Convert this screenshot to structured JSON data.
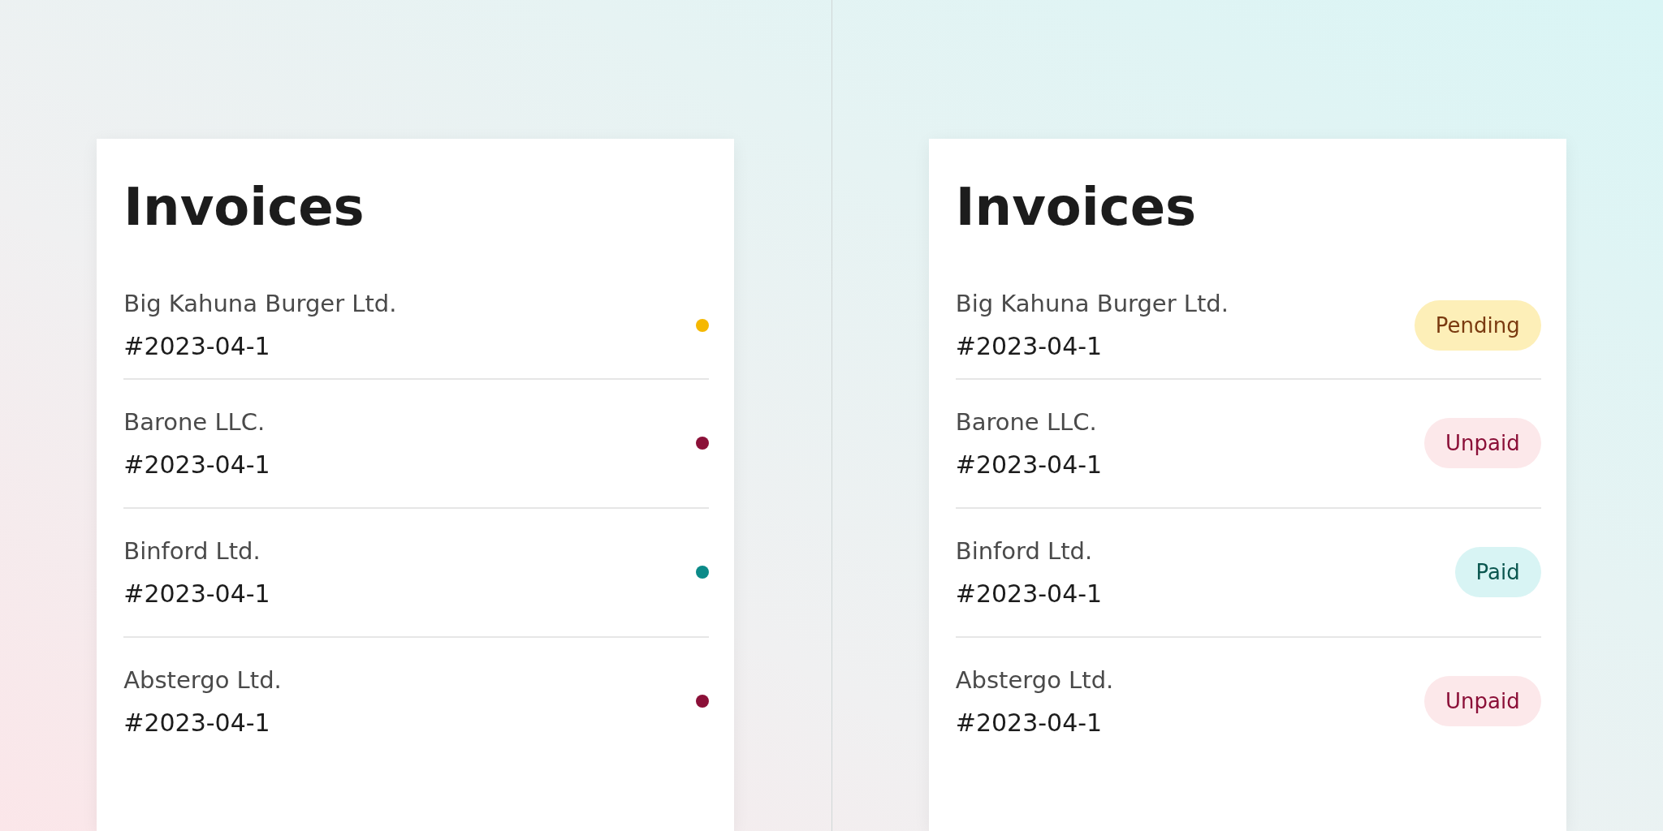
{
  "panels": [
    {
      "title": "Invoices",
      "items": [
        {
          "name": "Big Kahuna Burger Ltd.",
          "number": "#2023-04-1",
          "color": "#f5b800"
        },
        {
          "name": "Barone LLC.",
          "number": "#2023-04-1",
          "color": "#8b1038"
        },
        {
          "name": "Binford Ltd.",
          "number": "#2023-04-1",
          "color": "#0b8a88"
        },
        {
          "name": "Abstergo Ltd.",
          "number": "#2023-04-1",
          "color": "#8b1038"
        }
      ]
    },
    {
      "title": "Invoices",
      "items": [
        {
          "name": "Big Kahuna Burger Ltd.",
          "number": "#2023-04-1",
          "kind": "pending",
          "status": "Pending"
        },
        {
          "name": "Barone LLC.",
          "number": "#2023-04-1",
          "kind": "unpaid",
          "status": "Unpaid"
        },
        {
          "name": "Binford Ltd.",
          "number": "#2023-04-1",
          "kind": "paid",
          "status": "Paid"
        },
        {
          "name": "Abstergo Ltd.",
          "number": "#2023-04-1",
          "kind": "unpaid",
          "status": "Unpaid"
        }
      ]
    }
  ]
}
